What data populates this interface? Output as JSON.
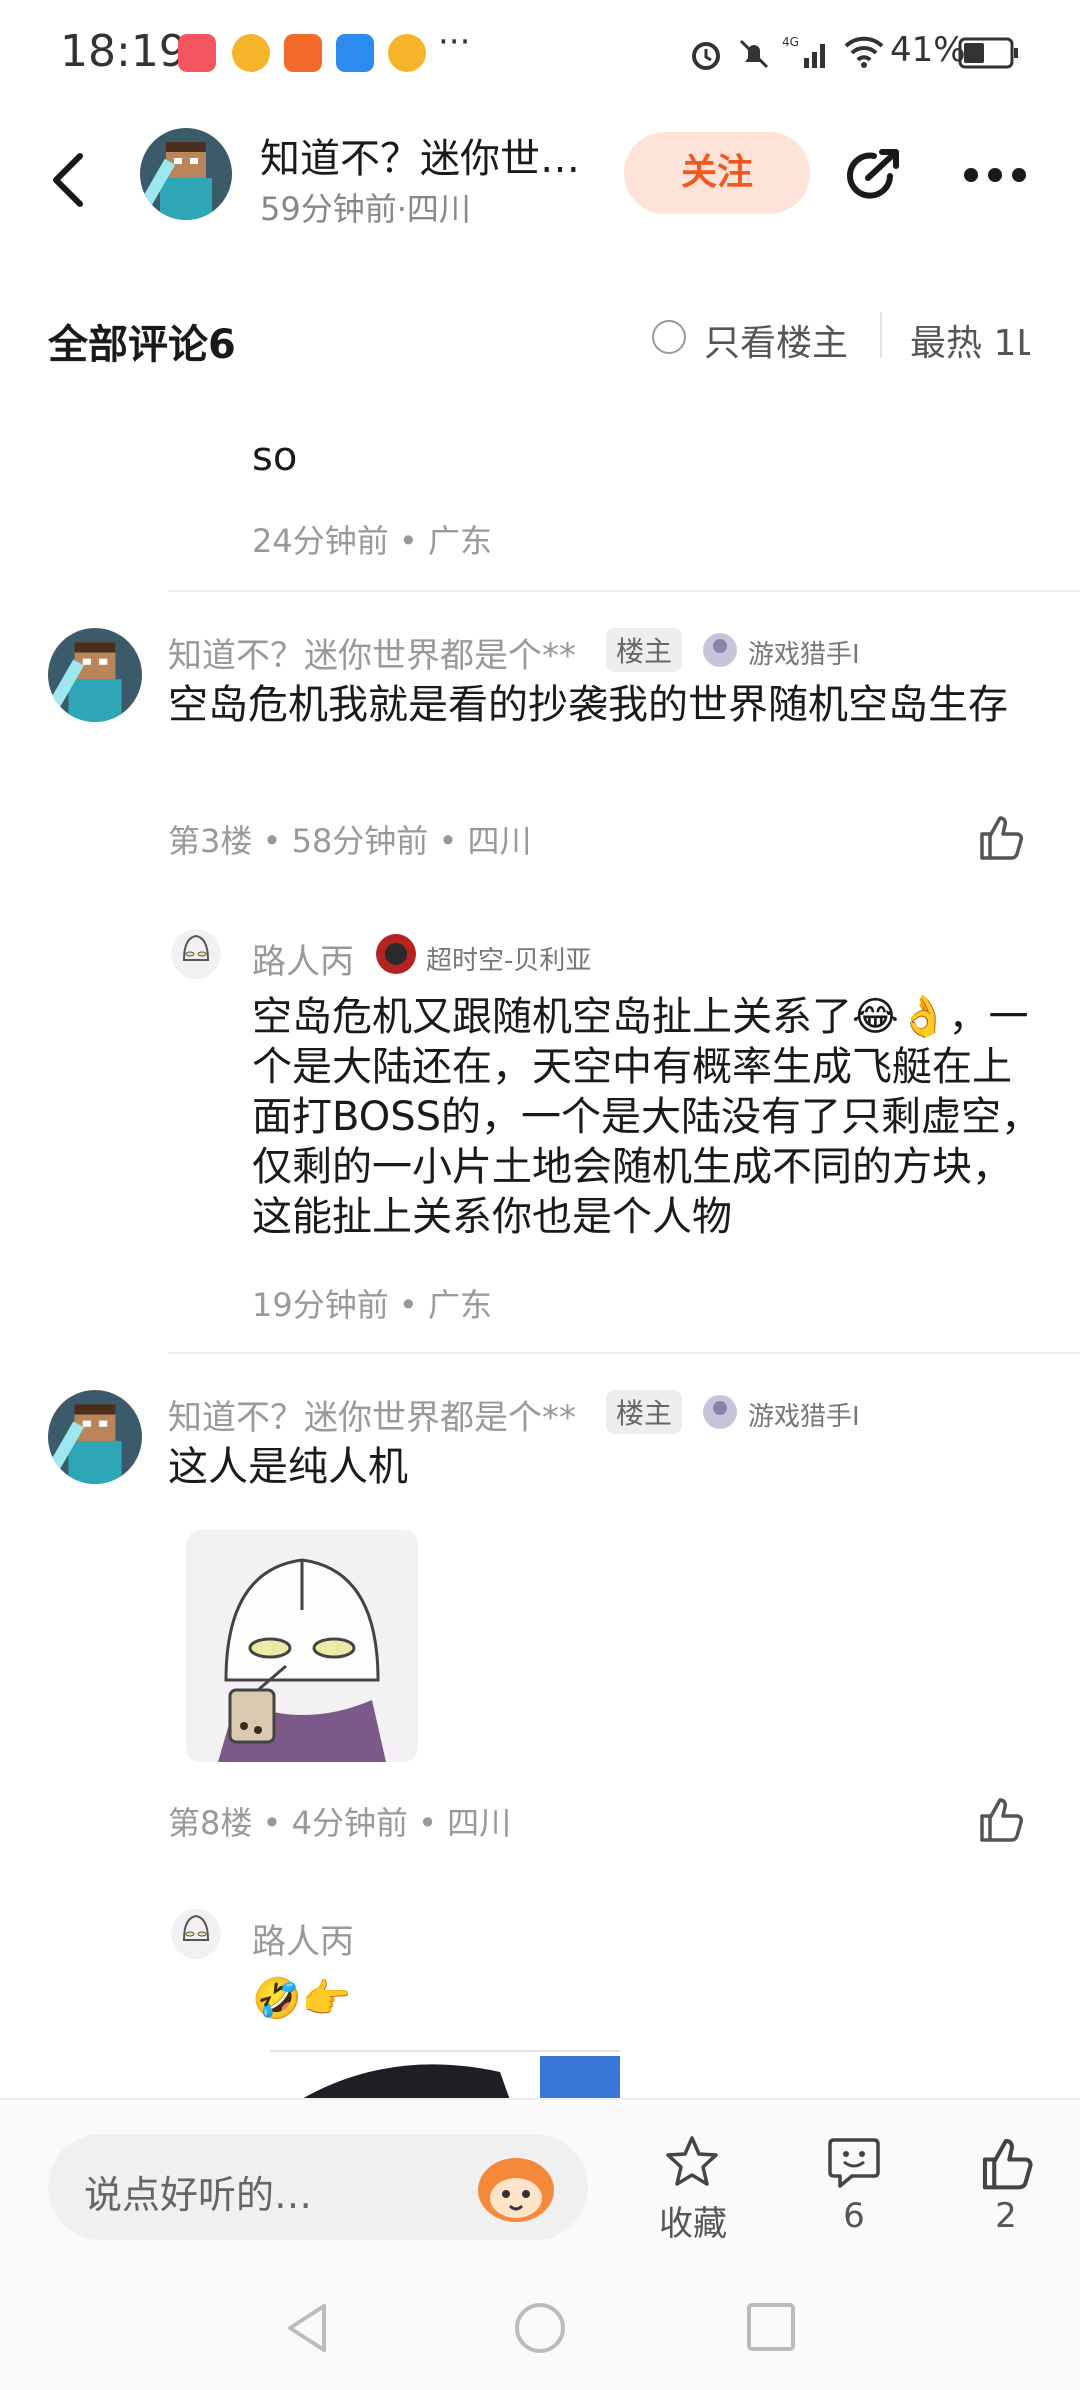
{
  "status_bar": {
    "time": "18:19",
    "battery": "41%",
    "dots": "···"
  },
  "header": {
    "title": "知道不？迷你世…",
    "subtitle": "59分钟前·四川",
    "follow_label": "关注"
  },
  "comments_header": {
    "title": "全部评论6",
    "only_host": "只看楼主",
    "sort": "最热 1L"
  },
  "comments": [
    {
      "text": "so",
      "meta": "24分钟前 • 广东"
    },
    {
      "author": "知道不？迷你世界都是个**",
      "badge": "楼主",
      "title_badge": "游戏猎手I",
      "text": "空岛危机我就是看的抄袭我的世界随机空岛生存",
      "meta": "第3楼 • 58分钟前 • 四川",
      "reply": {
        "author": "路人丙",
        "title_badge": "超时空-贝利亚",
        "text": "空岛危机又跟随机空岛扯上关系了😂👌，一个是大陆还在，天空中有概率生成飞艇在上面打BOSS的，一个是大陆没有了只剩虚空，仅剩的一小片土地会随机生成不同的方块，这能扯上关系你也是个人物",
        "meta": "19分钟前 • 广东"
      }
    },
    {
      "author": "知道不？迷你世界都是个**",
      "badge": "楼主",
      "title_badge": "游戏猎手I",
      "text": "这人是纯人机",
      "meta": "第8楼 • 4分钟前 • 四川",
      "reply": {
        "author": "路人丙",
        "text": "🤣👉"
      }
    }
  ],
  "bottom_bar": {
    "input_placeholder": "说点好听的…",
    "favorite_label": "收藏",
    "comment_count": "6",
    "like_count": "2"
  },
  "colors": {
    "accent": "#f2571f",
    "follow_bg": "#fde3d8",
    "meta": "#999999"
  },
  "icons": [
    "back-icon",
    "share-icon",
    "more-icon",
    "like-icon",
    "star-icon",
    "comment-icon",
    "mascot-icon",
    "nav-back-icon",
    "nav-home-icon",
    "nav-recents-icon"
  ]
}
